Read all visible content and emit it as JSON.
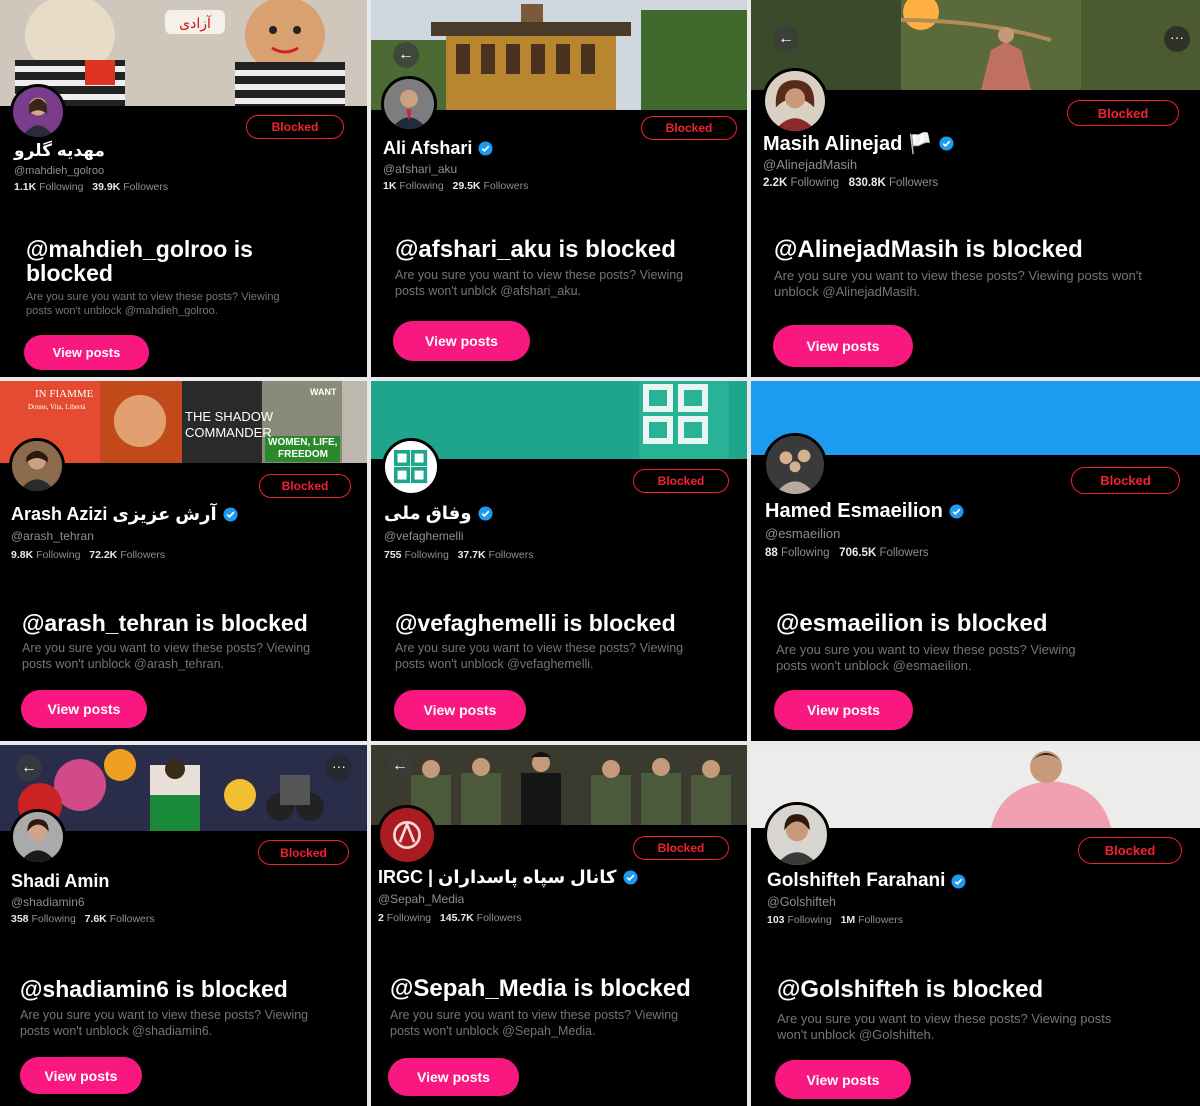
{
  "panels": [
    {
      "name": "مهدیه گلرو",
      "handle": "@mahdieh_golroo",
      "following": "1.1K",
      "followers": "39.9K",
      "following_label": "Following",
      "followers_label": "Followers",
      "blocked_label": "Blocked",
      "headline": "@mahdieh_golroo is blocked",
      "desc": "Are you sure you want to view these posts? Viewing posts won't unblock @mahdieh_golroo.",
      "button": "View posts",
      "verified": false
    },
    {
      "name": "Ali Afshari",
      "handle": "@afshari_aku",
      "following": "1K",
      "followers": "29.5K",
      "following_label": "Following",
      "followers_label": "Followers",
      "blocked_label": "Blocked",
      "headline": "@afshari_aku is blocked",
      "desc": "Are you sure you want to view these posts? Viewing posts won't unblck @afshari_aku.",
      "button": "View posts",
      "verified": true
    },
    {
      "name": "Masih Alinejad 🏳️",
      "handle": "@AlinejadMasih",
      "following": "2.2K",
      "followers": "830.8K",
      "following_label": "Following",
      "followers_label": "Followers",
      "blocked_label": "Blocked",
      "headline": "@AlinejadMasih is blocked",
      "desc": "Are you sure you want to view these posts? Viewing posts won't unblock @AlinejadMasih.",
      "button": "View posts",
      "verified": true
    },
    {
      "name": "Arash Azizi آرش عزیزی",
      "handle": "@arash_tehran",
      "following": "9.8K",
      "followers": "72.2K",
      "following_label": "Following",
      "followers_label": "Followers",
      "blocked_label": "Blocked",
      "headline": "@arash_tehran is blocked",
      "desc": "Are you sure you want to view these posts? Viewing posts won't unblock @arash_tehran.",
      "button": "View posts",
      "verified": true
    },
    {
      "name": "وفاق ملی",
      "handle": "@vefaghemelli",
      "following": "755",
      "followers": "37.7K",
      "following_label": "Following",
      "followers_label": "Followers",
      "blocked_label": "Blocked",
      "headline": "@vefaghemelli is blocked",
      "desc": "Are you sure you want to view these posts? Viewing posts won't unblock @vefaghemelli.",
      "button": "View posts",
      "verified": true
    },
    {
      "name": "Hamed Esmaeilion",
      "handle": "@esmaeilion",
      "following": "88",
      "followers": "706.5K",
      "following_label": "Following",
      "followers_label": "Followers",
      "blocked_label": "Blocked",
      "headline": "@esmaeilion is blocked",
      "desc": "Are you sure you want to view these posts? Viewing posts won't unblock @esmaeilion.",
      "button": "View posts",
      "verified": true
    },
    {
      "name": "Shadi Amin",
      "handle": "@shadiamin6",
      "following": "358",
      "followers": "7.6K",
      "following_label": "Following",
      "followers_label": "Followers",
      "blocked_label": "Blocked",
      "headline": "@shadiamin6 is blocked",
      "desc": "Are you sure you want to view these posts? Viewing posts won't unblock @shadiamin6.",
      "button": "View posts",
      "verified": false
    },
    {
      "name": "IRGC | کانال سپاه پاسداران",
      "handle": "@Sepah_Media",
      "following": "2",
      "followers": "145.7K",
      "following_label": "Following",
      "followers_label": "Followers",
      "blocked_label": "Blocked",
      "headline": "@Sepah_Media is blocked",
      "desc": "Are you sure you want to view these posts? Viewing posts won't unblock @Sepah_Media.",
      "button": "View posts",
      "verified": true
    },
    {
      "name": "Golshifteh Farahani",
      "handle": "@Golshifteh",
      "following": "103",
      "followers": "1M",
      "following_label": "Following",
      "followers_label": "Followers",
      "blocked_label": "Blocked",
      "headline": "@Golshifteh is blocked",
      "desc": "Are you sure you want to view these posts? Viewing posts won't unblock @Golshifteh.",
      "button": "View posts",
      "verified": true
    }
  ],
  "banner_text": {
    "fiamme_1": "IN FIAMME",
    "fiamme_2": "Donne, Vita, Libertà",
    "shadow_1": "THE SHADOW",
    "shadow_2": "COMMANDER",
    "women_1": "WOMEN, LIFE,",
    "women_2": "FREEDOM",
    "want": "WANT"
  },
  "colors": {
    "blocked": "#f4212e",
    "button": "#f91880",
    "verified": "#1d9bf0",
    "muted": "#71767b"
  }
}
